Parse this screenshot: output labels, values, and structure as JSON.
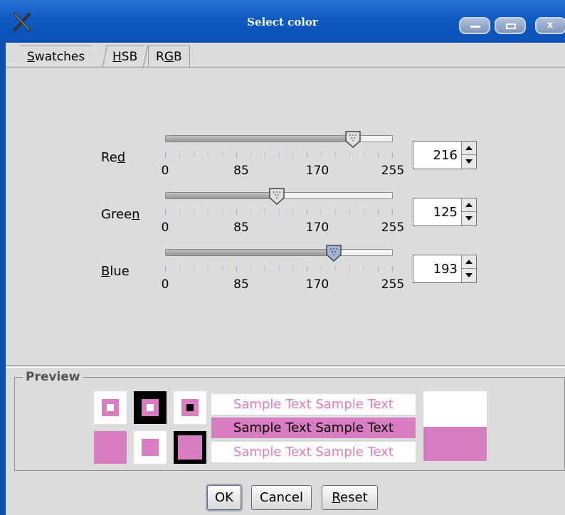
{
  "window": {
    "title": "Select color",
    "colors": {
      "titlebar": "#0e5ac4",
      "selected": "#d87dc1"
    }
  },
  "tabs": [
    {
      "prefix": "",
      "mnemonic": "S",
      "rest": "watches",
      "active": false
    },
    {
      "prefix": "",
      "mnemonic": "H",
      "rest": "SB",
      "active": false
    },
    {
      "prefix": "R",
      "mnemonic": "G",
      "rest": "B",
      "active": true
    }
  ],
  "sliders": [
    {
      "label_pre": "Re",
      "label_mnemonic": "d",
      "label_post": "",
      "value": "216",
      "max": 255,
      "thumb_color": "#e0e0e0"
    },
    {
      "label_pre": "Gree",
      "label_mnemonic": "n",
      "label_post": "",
      "value": "125",
      "max": 255,
      "thumb_color": "#e0e0e0"
    },
    {
      "label_pre": "",
      "label_mnemonic": "B",
      "label_post": "lue",
      "value": "193",
      "max": 255,
      "thumb_color": "#9fb4d6"
    }
  ],
  "scale": {
    "labels": [
      "0",
      "85",
      "170",
      "255"
    ]
  },
  "preview": {
    "title": "Preview",
    "sample_text": "Sample Text  Sample Text"
  },
  "buttons": {
    "ok": "OK",
    "cancel": "Cancel",
    "reset_mnemonic": "R",
    "reset_rest": "eset"
  }
}
